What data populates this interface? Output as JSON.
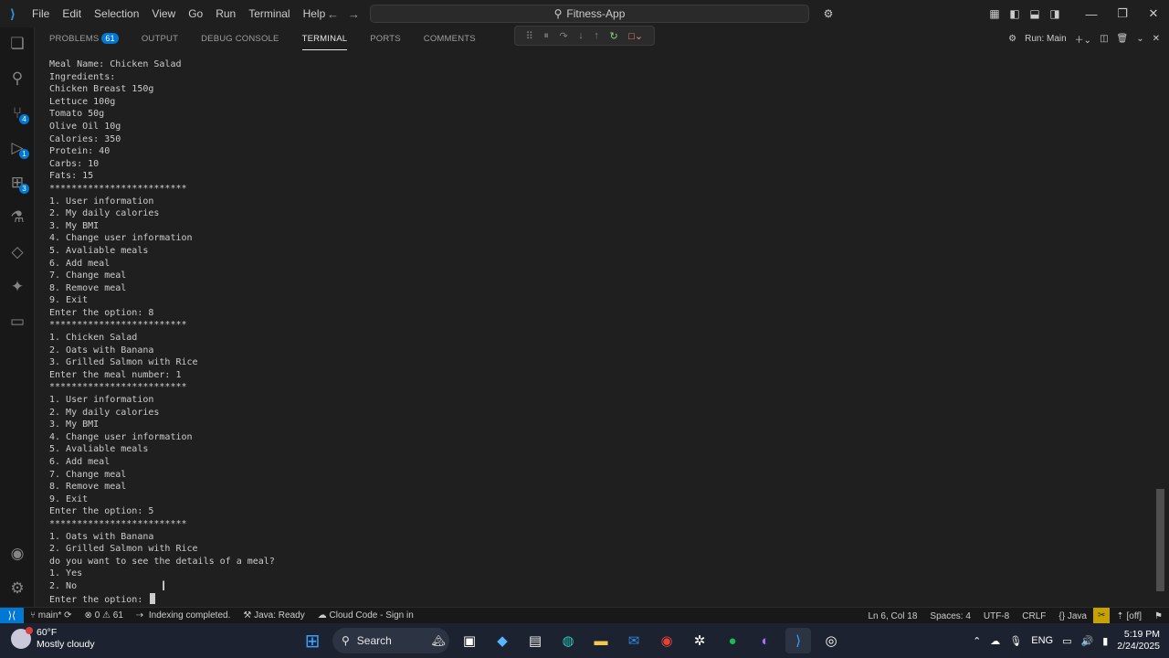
{
  "titlebar": {
    "menus": [
      "File",
      "Edit",
      "Selection",
      "View",
      "Go",
      "Run",
      "Terminal",
      "Help"
    ],
    "search_text": "Fitness-App"
  },
  "panel": {
    "tabs": [
      {
        "label": "PROBLEMS",
        "badge": "61"
      },
      {
        "label": "OUTPUT"
      },
      {
        "label": "DEBUG CONSOLE"
      },
      {
        "label": "TERMINAL",
        "active": true
      },
      {
        "label": "PORTS"
      },
      {
        "label": "COMMENTS"
      }
    ],
    "run_label": "Run: Main"
  },
  "terminal": {
    "lines": [
      "Meal Name: Chicken Salad",
      "Ingredients:",
      "Chicken Breast 150g",
      "Lettuce 100g",
      "Tomato 50g",
      "Olive Oil 10g",
      "Calories: 350",
      "Protein: 40",
      "Carbs: 10",
      "Fats: 15",
      "*************************",
      "1. User information",
      "2. My daily calories",
      "3. My BMI",
      "4. Change user information",
      "5. Avaliable meals",
      "6. Add meal",
      "7. Change meal",
      "8. Remove meal",
      "9. Exit",
      "Enter the option: 8",
      "*************************",
      "1. Chicken Salad",
      "2. Oats with Banana",
      "3. Grilled Salmon with Rice",
      "Enter the meal number: 1",
      "*************************",
      "1. User information",
      "2. My daily calories",
      "3. My BMI",
      "4. Change user information",
      "5. Avaliable meals",
      "6. Add meal",
      "7. Change meal",
      "8. Remove meal",
      "9. Exit",
      "Enter the option: 5",
      "*************************",
      "1. Oats with Banana",
      "2. Grilled Salmon with Rice",
      "do you want to see the details of a meal?",
      "1. Yes",
      "2. No"
    ],
    "prompt": "Enter the option: "
  },
  "statusbar": {
    "branch": "main*",
    "errors": "0",
    "warnings": "61",
    "indexing": "Indexing completed.",
    "java": "Java: Ready",
    "cloud": "Cloud Code - Sign in",
    "position": "Ln 6, Col 18",
    "spaces": "Spaces: 4",
    "encoding": "UTF-8",
    "eol": "CRLF",
    "language": "{} Java",
    "off": "[off]"
  },
  "taskbar": {
    "temperature": "60°F",
    "weather": "Mostly cloudy",
    "search": "Search",
    "lang": "ENG",
    "time": "5:19 PM",
    "date": "2/24/2025"
  },
  "colors": {
    "accent": "#0078d4",
    "background": "#1f1f1f",
    "status_highlight": "#c7a100"
  }
}
